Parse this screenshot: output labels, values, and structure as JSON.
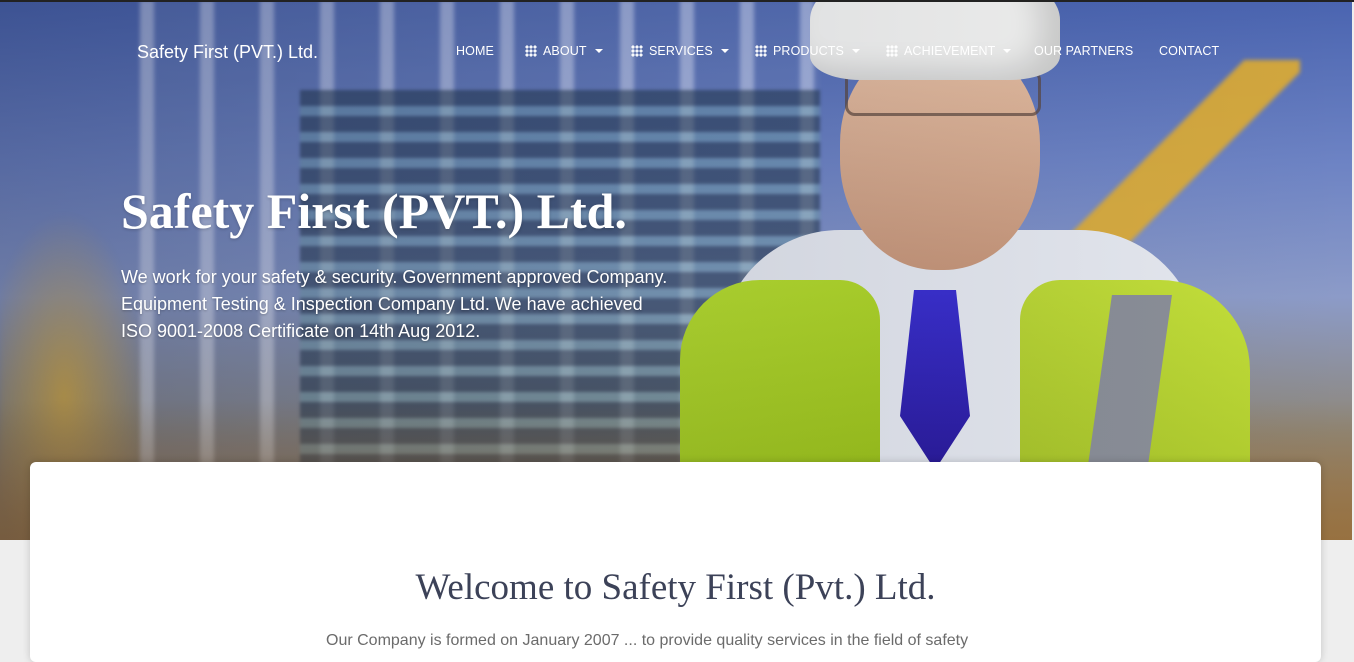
{
  "navbar": {
    "brand": "Safety First (PVT.) Ltd.",
    "items": [
      {
        "label": "HOME",
        "icon": "",
        "dropdown": false
      },
      {
        "label": "ABOUT",
        "icon": "grid-icon",
        "dropdown": true
      },
      {
        "label": "SERVICES",
        "icon": "grid-icon",
        "dropdown": true
      },
      {
        "label": "PRODUCTS",
        "icon": "grid-icon",
        "dropdown": true
      },
      {
        "label": "ACHIEVEMENT",
        "icon": "grid-icon",
        "dropdown": true
      },
      {
        "label": "OUR PARTNERS",
        "icon": "",
        "dropdown": false
      },
      {
        "label": "CONTACT",
        "icon": "",
        "dropdown": false
      }
    ]
  },
  "hero": {
    "title": "Safety First (PVT.) Ltd.",
    "description": "We work for your safety & security. Government approved Company. Equipment Testing & Inspection Company Ltd. We have achieved ISO 9001-2008 Certificate on 14th Aug 2012."
  },
  "main": {
    "heading": "Welcome to Safety First (Pvt.) Ltd.",
    "intro": "Our Company is formed on January 2007 ... to provide quality services in the field of safety"
  },
  "colors": {
    "heading": "#3c4258",
    "nav_text": "#ffffff",
    "card_bg": "#ffffff"
  }
}
